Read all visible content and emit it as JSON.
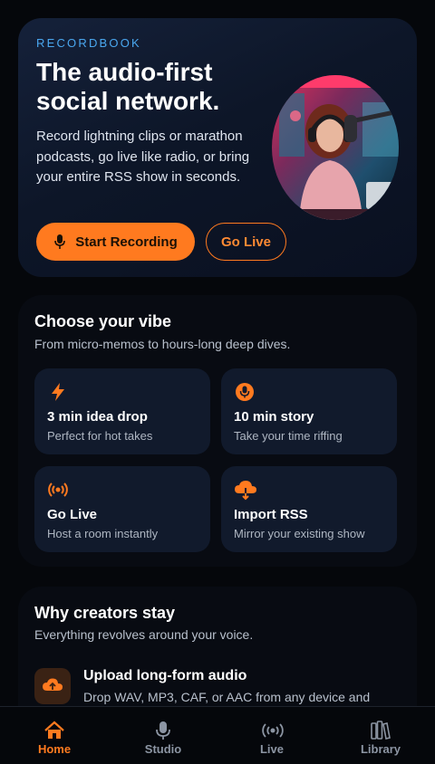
{
  "hero": {
    "brand": "RECORDBOOK",
    "title": "The audio-first social network.",
    "description": "Record lightning clips or marathon podcasts, go live like radio, or bring your entire RSS show in seconds.",
    "primary_cta": "Start Recording",
    "secondary_cta": "Go Live"
  },
  "vibe": {
    "title": "Choose your vibe",
    "subtitle": "From micro-memos to hours-long deep dives.",
    "tiles": [
      {
        "icon": "bolt-icon",
        "title": "3 min idea drop",
        "subtitle": "Perfect for hot takes"
      },
      {
        "icon": "microphone-icon",
        "title": "10 min story",
        "subtitle": "Take your time riffing"
      },
      {
        "icon": "broadcast-icon",
        "title": "Go Live",
        "subtitle": "Host a room instantly"
      },
      {
        "icon": "cloud-download-icon",
        "title": "Import RSS",
        "subtitle": "Mirror your existing show"
      }
    ]
  },
  "why": {
    "title": "Why creators stay",
    "subtitle": "Everything revolves around your voice.",
    "features": [
      {
        "icon": "cloud-upload-icon",
        "title": "Upload long-form audio",
        "description": "Drop WAV, MP3, CAF, or AAC from any device and"
      }
    ]
  },
  "nav": {
    "items": [
      {
        "label": "Home",
        "icon": "home-icon",
        "active": true
      },
      {
        "label": "Studio",
        "icon": "microphone-icon",
        "active": false
      },
      {
        "label": "Live",
        "icon": "broadcast-icon",
        "active": false
      },
      {
        "label": "Library",
        "icon": "library-icon",
        "active": false
      }
    ]
  },
  "colors": {
    "accent": "#ff7a1f",
    "brand_blue": "#4aa7ef",
    "background": "#05070b",
    "tile": "#111a2c"
  }
}
